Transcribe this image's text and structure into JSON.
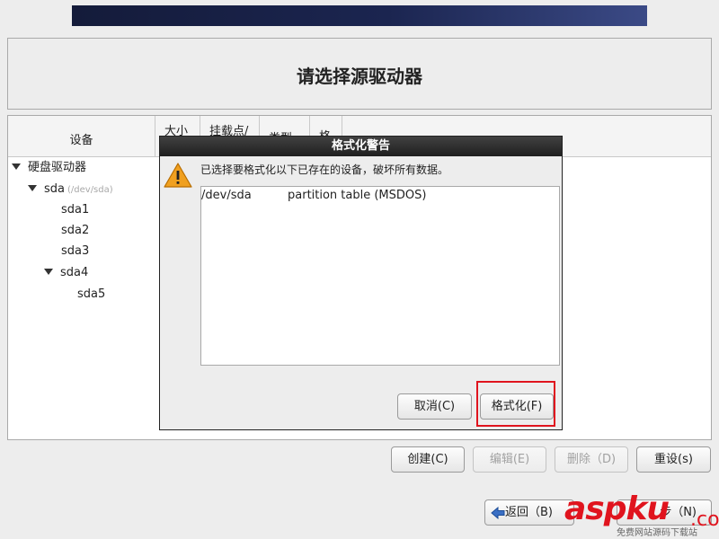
{
  "header": {
    "title": "请选择源驱动器"
  },
  "table": {
    "columns": [
      "设备",
      "大小",
      "挂载点/",
      "类型",
      "格式"
    ],
    "tree": [
      {
        "label": "硬盘驱动器",
        "expanded": true
      },
      {
        "label": "sda",
        "sublabel": "(/dev/sda)",
        "expanded": true
      },
      {
        "label": "sda1"
      },
      {
        "label": "sda2"
      },
      {
        "label": "sda3"
      },
      {
        "label": "sda4",
        "expanded": true
      },
      {
        "label": "sda5"
      }
    ]
  },
  "dialog": {
    "title": "格式化警告",
    "icon": "warning-icon",
    "message": "已选择要格式化以下已存在的设备，破坏所有数据。",
    "items": [
      {
        "device": "/dev/sda",
        "description": "partition table (MSDOS)"
      }
    ],
    "cancel_label": "取消(C)",
    "format_label": "格式化(F)"
  },
  "actions": {
    "create_label": "创建(C)",
    "edit_label": "编辑(E)",
    "delete_label": "删除（D)",
    "reset_label": "重设(s)"
  },
  "nav": {
    "back_label": "返回（B)",
    "next_label": "步（N)"
  },
  "watermark": {
    "brand": "aspku",
    "suffix": ".com",
    "tagline": "免费网站源码下载站"
  },
  "colors": {
    "highlight": "#e0141e",
    "banner": "#1b2550"
  }
}
